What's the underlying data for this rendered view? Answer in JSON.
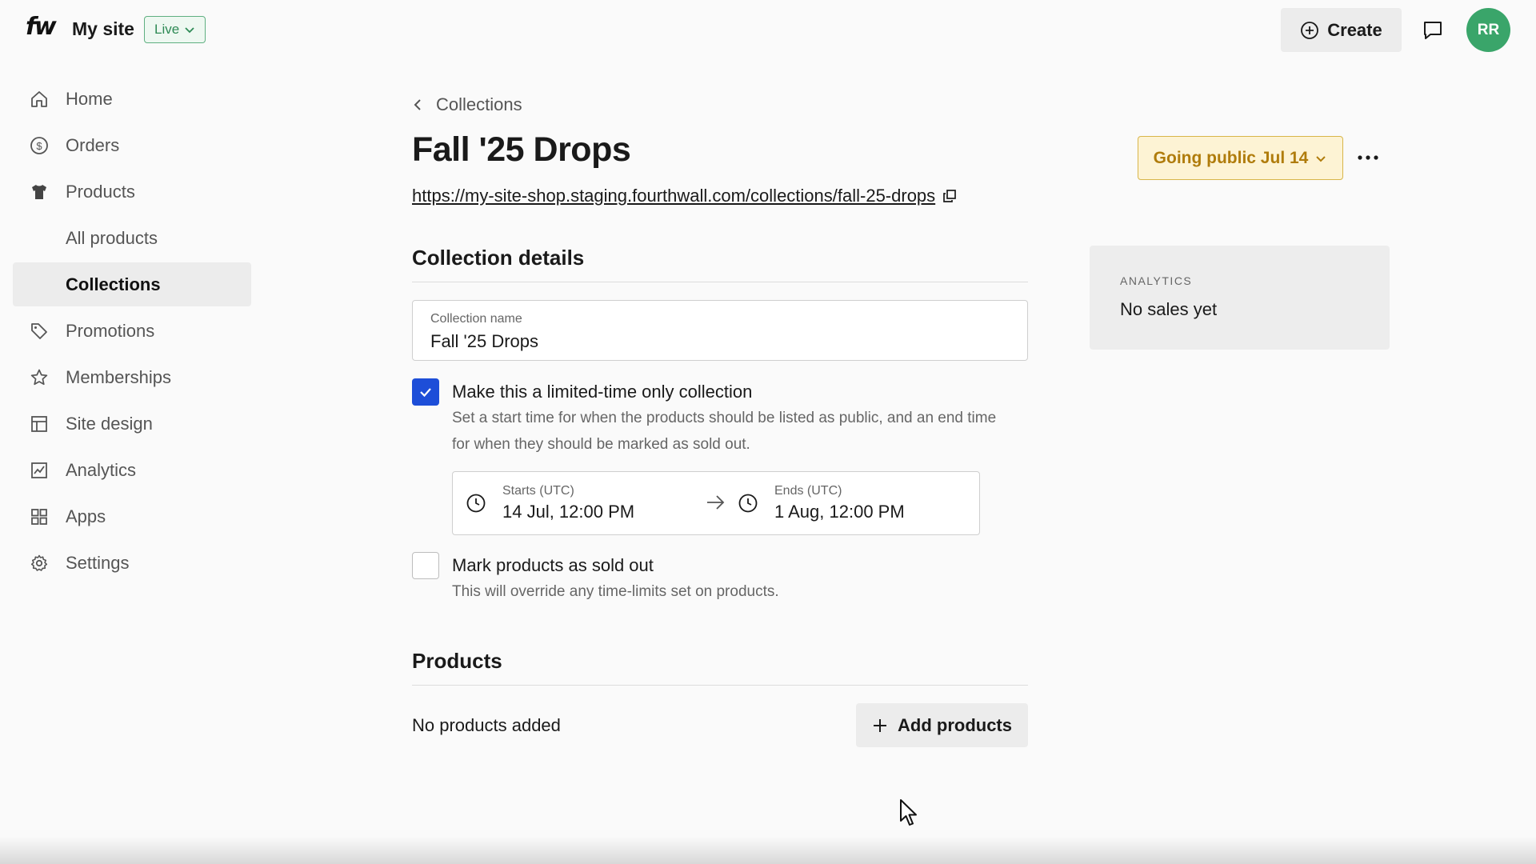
{
  "topbar": {
    "logo": "fw",
    "site_name": "My site",
    "live_badge": "Live",
    "create_label": "Create",
    "avatar_initials": "RR"
  },
  "sidebar": {
    "items": [
      {
        "label": "Home",
        "icon": "home-icon"
      },
      {
        "label": "Orders",
        "icon": "dollar-circle-icon"
      },
      {
        "label": "Products",
        "icon": "tshirt-icon"
      },
      {
        "label": "All products",
        "icon": ""
      },
      {
        "label": "Collections",
        "icon": "",
        "active": true
      },
      {
        "label": "Promotions",
        "icon": "tag-icon"
      },
      {
        "label": "Memberships",
        "icon": "star-icon"
      },
      {
        "label": "Site design",
        "icon": "layout-icon"
      },
      {
        "label": "Analytics",
        "icon": "chart-icon"
      },
      {
        "label": "Apps",
        "icon": "grid-icon"
      },
      {
        "label": "Settings",
        "icon": "gear-icon"
      }
    ]
  },
  "header": {
    "back_label": "Collections",
    "title": "Fall '25 Drops",
    "url": "https://my-site-shop.staging.fourthwall.com/collections/fall-25-drops",
    "status_label": "Going public Jul 14"
  },
  "analytics": {
    "label": "ANALYTICS",
    "value": "No sales yet"
  },
  "details": {
    "section_title": "Collection details",
    "name_label": "Collection name",
    "name_value": "Fall '25 Drops",
    "limited_label": "Make this a limited-time only collection",
    "limited_help_1": "Set a start time for when the products should be listed as public, and an end time",
    "limited_help_2": "for when they should be marked as sold out.",
    "starts_label": "Starts (UTC)",
    "starts_value": "14 Jul, 12:00 PM",
    "ends_label": "Ends (UTC)",
    "ends_value": "1 Aug, 12:00 PM",
    "soldout_label": "Mark products as sold out",
    "soldout_help": "This will override any time-limits set on products."
  },
  "products": {
    "section_title": "Products",
    "empty_text": "No products added",
    "add_label": "Add products"
  },
  "colors": {
    "accent_blue": "#1d4ed8",
    "live_green": "#2e8a55",
    "avatar_green": "#3aa56a",
    "status_gold": "#b07c0c"
  }
}
